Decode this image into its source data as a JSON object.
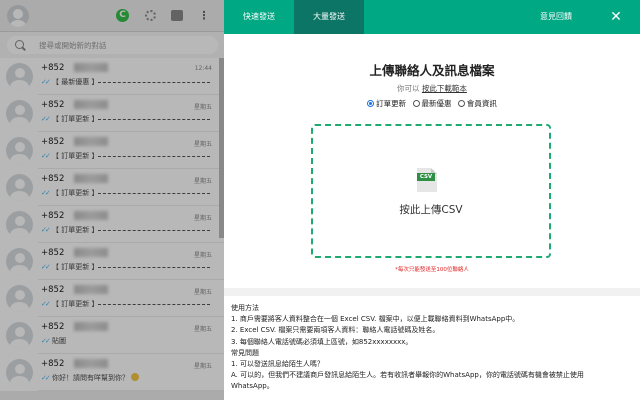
{
  "sidebar": {
    "search_placeholder": "搜尋或開始新的對話",
    "chats": [
      {
        "name": "+852",
        "time": "12:44",
        "preview": "【 最新優惠 】",
        "dashes": true,
        "emoji": false
      },
      {
        "name": "+852",
        "time": "星期五",
        "preview": "【 訂單更新 】",
        "dashes": true,
        "emoji": false
      },
      {
        "name": "+852",
        "time": "星期五",
        "preview": "【 訂單更新 】",
        "dashes": true,
        "emoji": false
      },
      {
        "name": "+852",
        "time": "星期五",
        "preview": "【 訂單更新 】",
        "dashes": true,
        "emoji": false
      },
      {
        "name": "+852",
        "time": "星期五",
        "preview": "【 訂單更新 】",
        "dashes": true,
        "emoji": false
      },
      {
        "name": "+852",
        "time": "星期五",
        "preview": "【 訂單更新 】",
        "dashes": true,
        "emoji": false
      },
      {
        "name": "+852",
        "time": "星期五",
        "preview": "【 訂單更新 】",
        "dashes": true,
        "emoji": false
      },
      {
        "name": "+852",
        "time": "星期五",
        "preview": "貼圖",
        "dashes": false,
        "emoji": false
      },
      {
        "name": "+852",
        "time": "星期五",
        "preview": "你好！請問有咩幫到你？",
        "dashes": false,
        "emoji": true
      }
    ]
  },
  "header": {
    "tab_quick": "快速發送",
    "tab_bulk": "大量發送",
    "feedback": "意見回饋",
    "close": "✕"
  },
  "main": {
    "title": "上傳聯絡人及訊息檔案",
    "download_prefix": "你可以",
    "download_link": "按此下載範本",
    "radios": [
      {
        "label": "訂單更新",
        "checked": true
      },
      {
        "label": "最新優惠",
        "checked": false
      },
      {
        "label": "會員資訊",
        "checked": false
      }
    ],
    "csv_tag": "CSV",
    "dropzone_label": "按此上傳CSV",
    "limit_note": "*每次只能發送至100位聯絡人"
  },
  "instructions": {
    "lines": [
      "使用方法",
      "1. 商戶需要將客人資料整合在一個 Excel CSV. 檔案中，以便上載聯絡資料到WhatsApp中。",
      "2. Excel CSV. 檔案只需要兩項客人資料：聯絡人電話號碼及姓名。",
      "3. 每個聯絡人電話號碼必須填上區號，如852xxxxxxxx。",
      "常見問題",
      "1. 可以發送訊息給陌生人嗎？",
      "A. 可以的，但我們不建議商戶發訊息給陌生人。若有收訊者舉報你的WhatsApp，你的電話號碼有機會被禁止使用",
      "WhatsApp。"
    ]
  },
  "colors": {
    "brand": "#00a884",
    "active_tab": "#0d7565",
    "dropzone_border": "#1ea971",
    "warning": "#e02020"
  }
}
